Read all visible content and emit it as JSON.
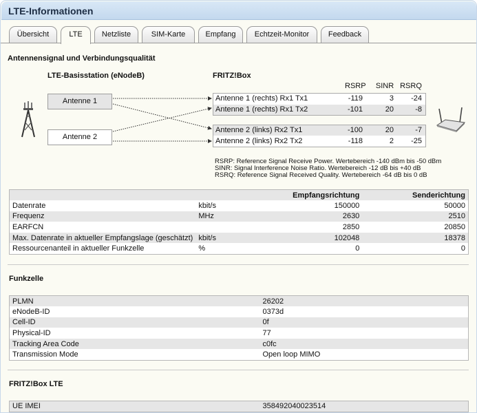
{
  "title": "LTE-Informationen",
  "tabs": [
    "Übersicht",
    "LTE",
    "Netzliste",
    "SIM-Karte",
    "Empfang",
    "Echtzeit-Monitor",
    "Feedback"
  ],
  "signal": {
    "heading": "Antennensignal und Verbindungsqualität",
    "base_station": "LTE-Basisstation (eNodeB)",
    "fritzbox": "FRITZ!Box",
    "ant1": "Antenne 1",
    "ant2": "Antenne 2",
    "cols": [
      "RSRP",
      "SINR",
      "RSRQ"
    ],
    "rows": [
      {
        "label": "Antenne 1 (rechts) Rx1 Tx1",
        "rsrp": "-119",
        "sinr": "3",
        "rsrq": "-24"
      },
      {
        "label": "Antenne 1 (rechts) Rx1 Tx2",
        "rsrp": "-101",
        "sinr": "20",
        "rsrq": "-8"
      },
      {
        "label": "Antenne 2 (links) Rx2 Tx1",
        "rsrp": "-100",
        "sinr": "20",
        "rsrq": "-7"
      },
      {
        "label": "Antenne 2 (links) Rx2 Tx2",
        "rsrp": "-118",
        "sinr": "2",
        "rsrq": "-25"
      }
    ],
    "legend": [
      "RSRP: Reference Signal Receive Power. Wertebereich -140 dBm bis -50 dBm",
      "SINR: Signal Interference Noise Ratio. Wertebereich -12 dB bis +40 dB",
      "RSRQ: Reference Signal Received Quality. Wertebereich -64 dB bis 0 dB"
    ]
  },
  "rates": {
    "head": [
      "",
      "",
      "Empfangsrichtung",
      "Senderichtung"
    ],
    "rows": [
      [
        "Datenrate",
        "kbit/s",
        "150000",
        "50000"
      ],
      [
        "Frequenz",
        "MHz",
        "2630",
        "2510"
      ],
      [
        "EARFCN",
        "",
        "2850",
        "20850"
      ],
      [
        "Max. Datenrate in aktueller Empfangslage (geschätzt)",
        "kbit/s",
        "102048",
        "18378"
      ],
      [
        "Ressourcenanteil in aktueller Funkzelle",
        "%",
        "0",
        "0"
      ]
    ]
  },
  "cell": {
    "heading": "Funkzelle",
    "rows": [
      [
        "PLMN",
        "26202"
      ],
      [
        "eNodeB-ID",
        "0373d"
      ],
      [
        "Cell-ID",
        "0f"
      ],
      [
        "Physical-ID",
        "77"
      ],
      [
        "Tracking Area Code",
        "c0fc"
      ],
      [
        "Transmission Mode",
        "Open loop MIMO"
      ]
    ]
  },
  "device": {
    "heading": "FRITZ!Box LTE",
    "rows": [
      [
        "UE IMEI",
        "358492040023514"
      ]
    ]
  }
}
